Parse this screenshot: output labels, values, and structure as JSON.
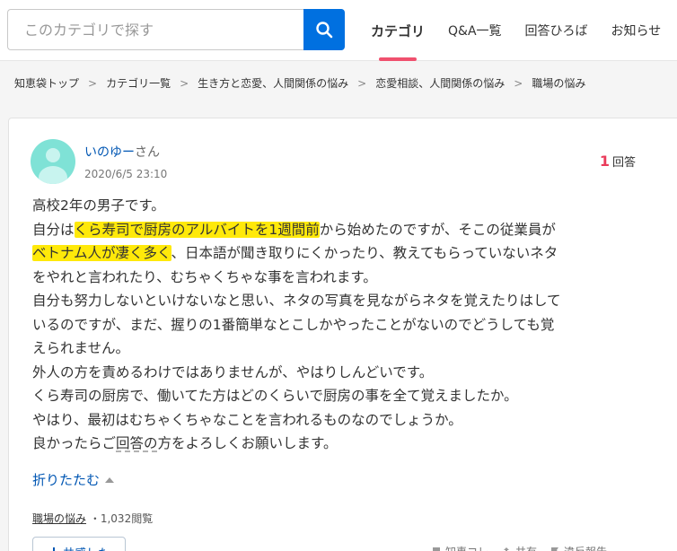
{
  "search": {
    "placeholder": "このカテゴリで探す"
  },
  "nav": {
    "tabs": [
      {
        "label": "カテゴリ"
      },
      {
        "label": "Q&A一覧"
      },
      {
        "label": "回答ひろば"
      },
      {
        "label": "お知らせ"
      }
    ]
  },
  "breadcrumb": [
    {
      "label": "知恵袋トップ"
    },
    {
      "label": "カテゴリ一覧"
    },
    {
      "label": "生き方と恋愛、人間関係の悩み"
    },
    {
      "label": "恋愛相談、人間関係の悩み"
    },
    {
      "label": "職場の悩み"
    }
  ],
  "question": {
    "user_name": "いのゆー",
    "user_suffix": "さん",
    "date": "2020/6/5 23:10",
    "answer_count": "1",
    "answer_label": "回答",
    "lines": {
      "l1": "高校2年の男子です。",
      "l2_a": "自分は",
      "l2_hl": "くら寿司で厨房のアルバイトを1週間前",
      "l2_b": "から始めたのですが、そこの従業員が",
      "l3_hl": "ベトナム人が凄く多く",
      "l3_b": "、日本語が聞き取りにくかったり、教えてもらっていないネタ",
      "l4": "をやれと言われたり、むちゃくちゃな事を言われます。",
      "l5": "自分も努力しないといけないなと思い、ネタの写真を見ながらネタを覚えたりはして",
      "l6": "いるのですが、まだ、握りの1番簡単なとこしかやったことがないのでどうしても覚",
      "l7": "えられません。",
      "l8": "外人の方を責めるわけではありませんが、やはりしんどいです。",
      "l9": "くら寿司の厨房で、働いてた方はどのくらいで厨房の事を全て覚えましたか。",
      "l10": "やはり、最初はむちゃくちゃなことを言われるものなのでしょうか。",
      "l11_a": "良かったらご",
      "l11_ul": "回答の",
      "l11_b": "方をよろしくお願いします。"
    },
    "fold_label": "折りたたむ",
    "category": "職場の悩み",
    "views": "・1,032閲覧",
    "empathy_label": "共感した",
    "actions": [
      {
        "label": "知恵コレ",
        "icon": "bookmark-icon"
      },
      {
        "label": "共有",
        "icon": "share-icon"
      },
      {
        "label": "違反報告",
        "icon": "flag-icon"
      }
    ]
  },
  "colors": {
    "accent": "#0070e0",
    "tab_indicator": "#f0506e",
    "answer_count": "#ea3b5a",
    "highlight": "#ffe90a"
  }
}
